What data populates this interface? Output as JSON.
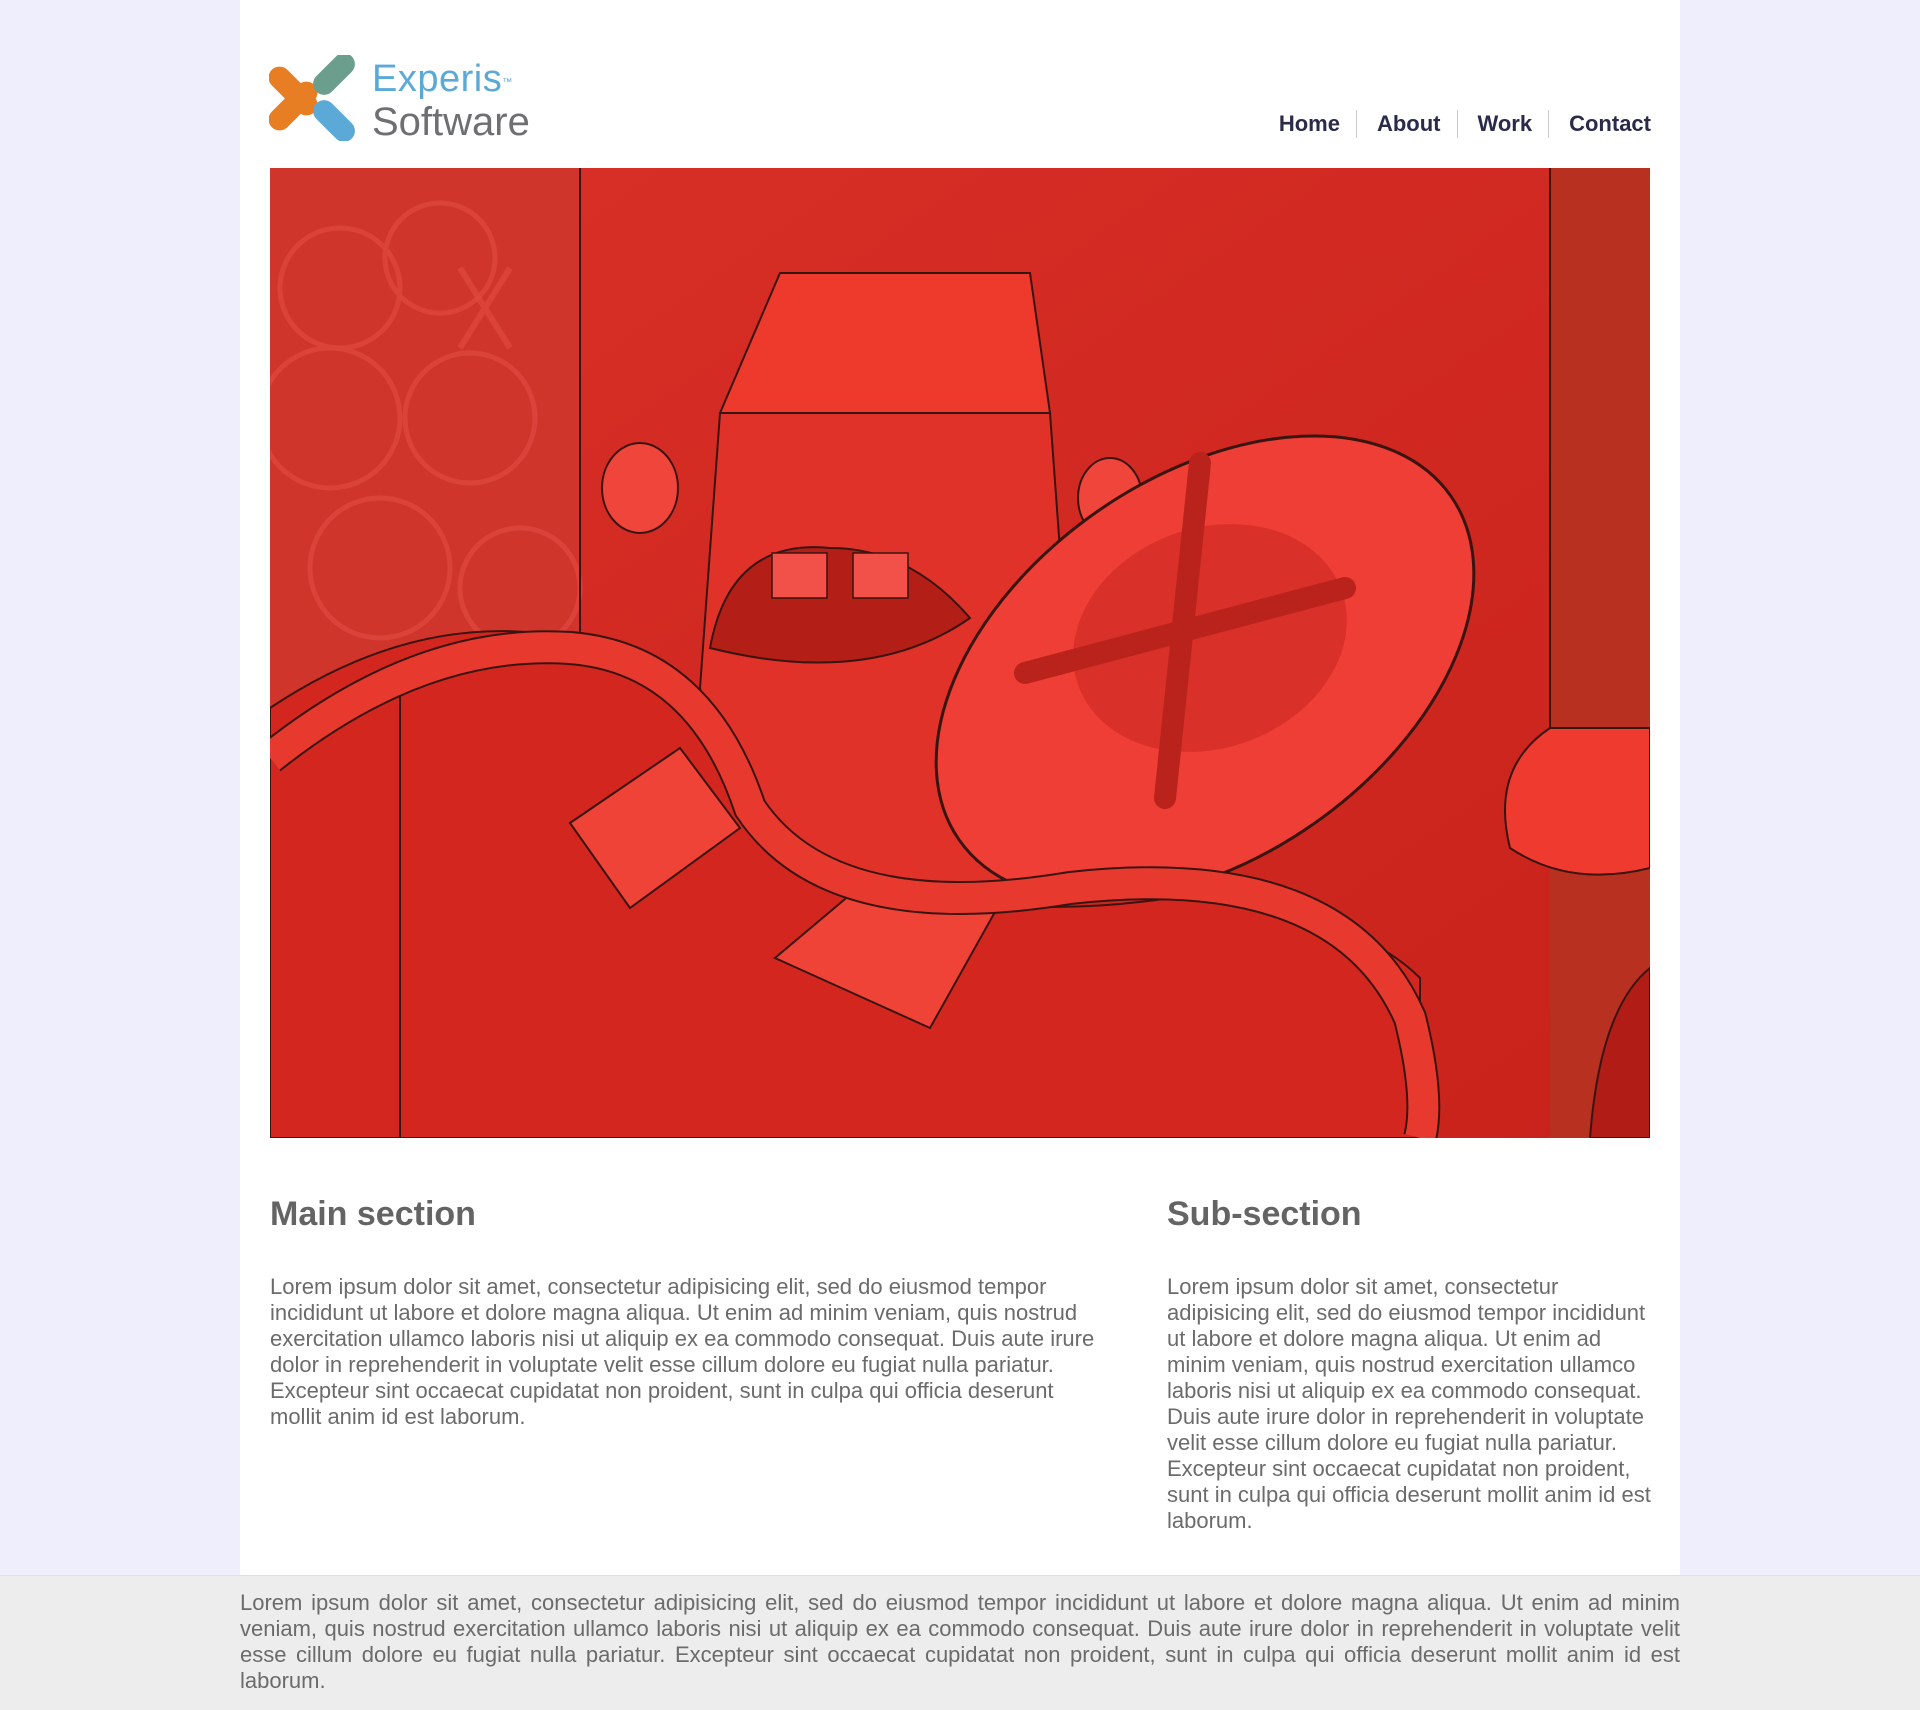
{
  "brand": {
    "name_line1": "Experis",
    "trademark": "™",
    "name_line2": "Software",
    "colors": {
      "orange": "#e87e23",
      "teal": "#6b9e8c",
      "blue": "#5aa9d6",
      "gray": "#6d6f73"
    }
  },
  "nav": {
    "items": [
      {
        "label": "Home"
      },
      {
        "label": "About"
      },
      {
        "label": "Work"
      },
      {
        "label": "Contact"
      }
    ]
  },
  "hero": {
    "description_colors": {
      "primary": "#d92a22",
      "accent": "#ef3b30"
    }
  },
  "main_section": {
    "heading": "Main section",
    "text": "Lorem ipsum dolor sit amet, consectetur adipisicing elit, sed do eiusmod tempor incididunt ut labore et dolore magna aliqua. Ut enim ad minim veniam, quis nostrud exercitation ullamco laboris nisi ut aliquip ex ea commodo consequat. Duis aute irure dolor in reprehenderit in voluptate velit esse cillum dolore eu fugiat nulla pariatur. Excepteur sint occaecat cupidatat non proident, sunt in culpa qui officia deserunt mollit anim id est laborum."
  },
  "sub_section": {
    "heading": "Sub-section",
    "text": "Lorem ipsum dolor sit amet, consectetur adipisicing elit, sed do eiusmod tempor incididunt ut labore et dolore magna aliqua. Ut enim ad minim veniam, quis nostrud exercitation ullamco laboris nisi ut aliquip ex ea commodo consequat. Duis aute irure dolor in reprehenderit in voluptate velit esse cillum dolore eu fugiat nulla pariatur. Excepteur sint occaecat cupidatat non proident, sunt in culpa qui officia deserunt mollit anim id est laborum."
  },
  "footer": {
    "text": "Lorem ipsum dolor sit amet, consectetur adipisicing elit, sed do eiusmod tempor incididunt ut labore et dolore magna aliqua. Ut enim ad minim veniam, quis nostrud exercitation ullamco laboris nisi ut aliquip ex ea commodo consequat. Duis aute irure dolor in reprehenderit in voluptate velit esse cillum dolore eu fugiat nulla pariatur. Excepteur sint occaecat cupidatat non proident, sunt in culpa qui officia deserunt mollit anim id est laborum."
  }
}
